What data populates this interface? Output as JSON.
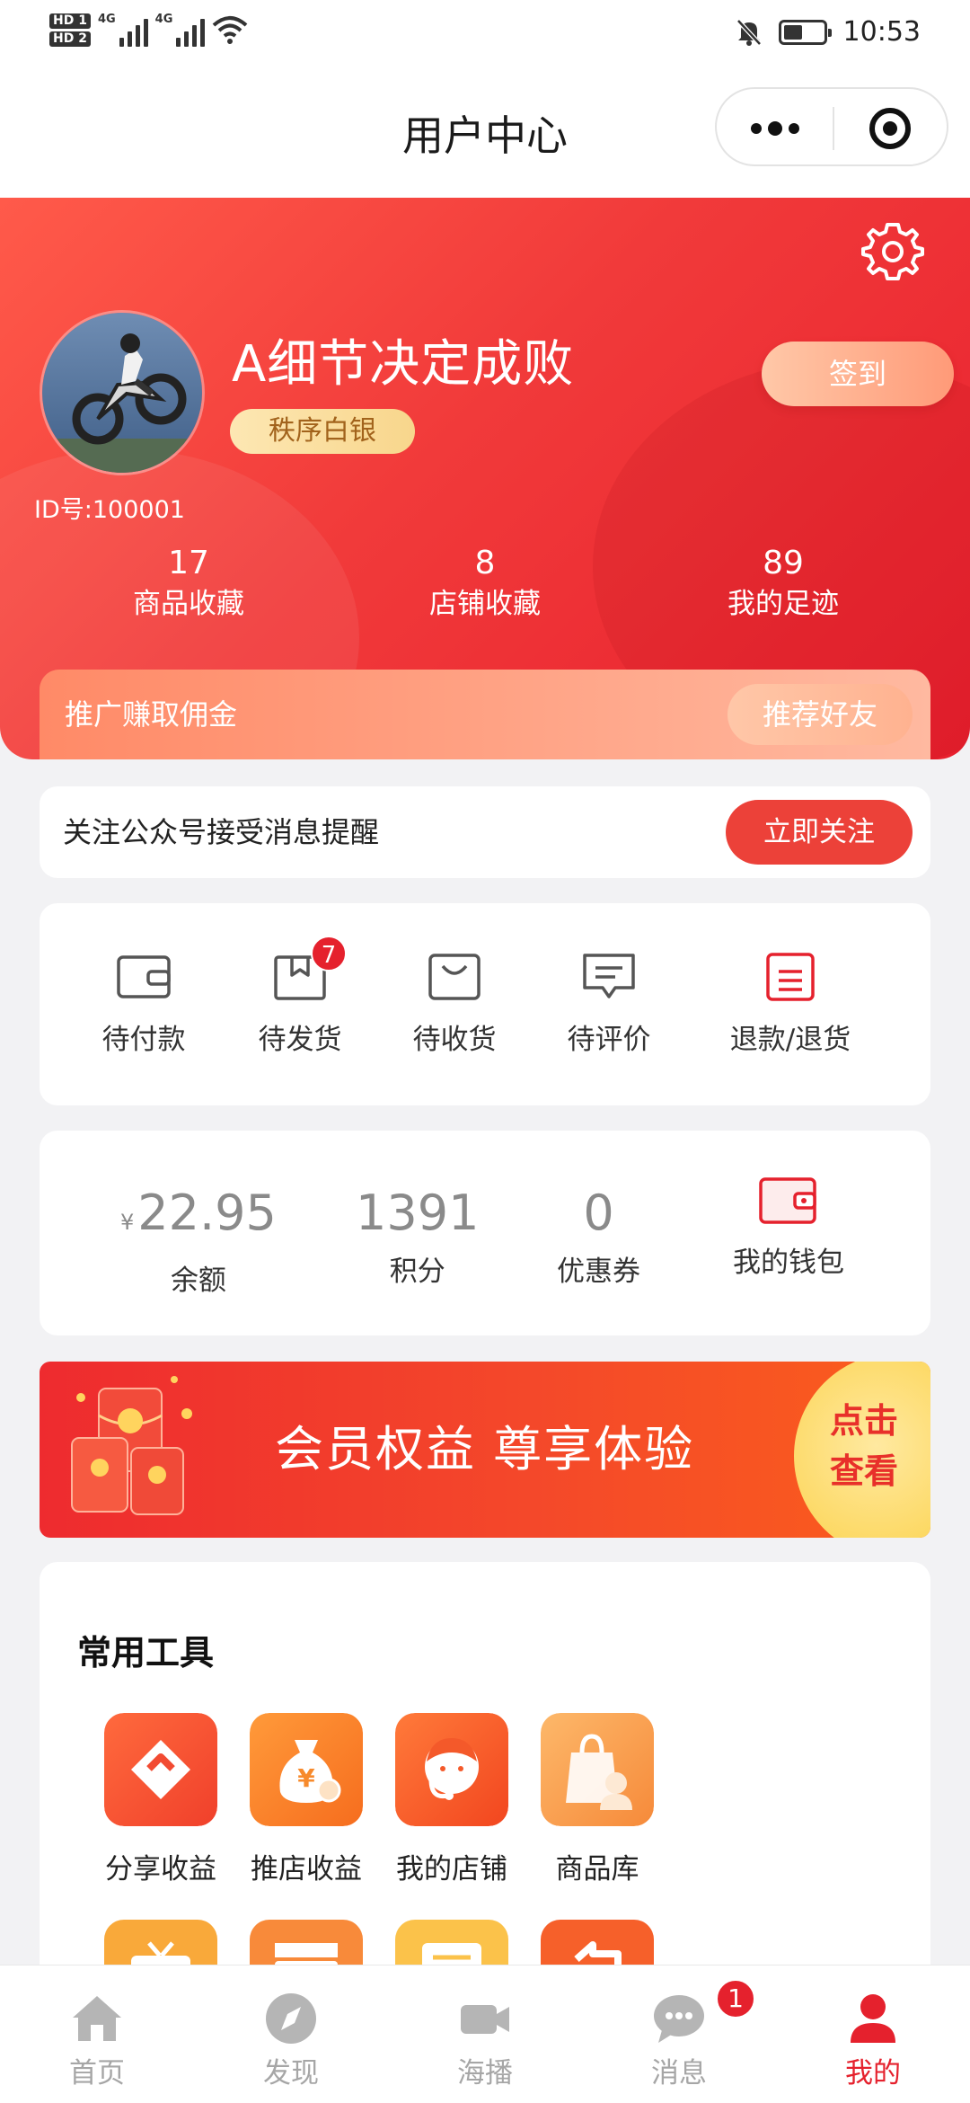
{
  "status_bar": {
    "hd1": "HD 1",
    "hd2": "HD 2",
    "net1": "4G",
    "net2": "4G",
    "time": "10:53",
    "icons": [
      "signal-icon",
      "wifi-icon",
      "mute-icon",
      "battery-icon"
    ]
  },
  "nav": {
    "title": "用户中心",
    "more_icon": "more-dots-icon",
    "close_icon": "miniprogram-target-icon"
  },
  "profile": {
    "name": "A细节决定成败",
    "level": "秩序白银",
    "id_text": "ID号:100001",
    "signin_label": "签到",
    "settings_icon": "gear-icon"
  },
  "stats": [
    {
      "value": "17",
      "label": "商品收藏"
    },
    {
      "value": "8",
      "label": "店铺收藏"
    },
    {
      "value": "89",
      "label": "我的足迹"
    }
  ],
  "promo": {
    "text": "推广赚取佣金",
    "button": "推荐好友"
  },
  "follow": {
    "text": "关注公众号接受消息提醒",
    "button": "立即关注"
  },
  "orders": [
    {
      "label": "待付款",
      "icon": "wallet-icon"
    },
    {
      "label": "待发货",
      "icon": "box-icon",
      "badge": "7"
    },
    {
      "label": "待收货",
      "icon": "bag-icon"
    },
    {
      "label": "待评价",
      "icon": "comment-icon"
    },
    {
      "label": "退款/退货",
      "icon": "refund-icon"
    }
  ],
  "wallet": {
    "currency": "¥",
    "balance": "22.95",
    "balance_label": "余额",
    "points": "1391",
    "points_label": "积分",
    "coupons": "0",
    "coupons_label": "优惠券",
    "wallet_label": "我的钱包",
    "wallet_icon": "wallet-icon"
  },
  "vip_banner": {
    "title": "会员权益 尊享体验",
    "cta": "点击查看"
  },
  "tools": {
    "title": "常用工具",
    "items": [
      {
        "label": "分享收益",
        "icon": "handshake-icon"
      },
      {
        "label": "推店收益",
        "icon": "money-bag-icon"
      },
      {
        "label": "我的店铺",
        "icon": "shopkeeper-icon"
      },
      {
        "label": "商品库",
        "icon": "shopping-bag-icon"
      }
    ],
    "row2_icons": [
      "tv-icon",
      "clapper-icon",
      "document-icon",
      "return-icon"
    ]
  },
  "tabs": [
    {
      "label": "首页",
      "icon": "home-icon"
    },
    {
      "label": "发现",
      "icon": "compass-icon"
    },
    {
      "label": "海播",
      "icon": "video-camera-icon"
    },
    {
      "label": "消息",
      "icon": "chat-icon",
      "badge": "1"
    },
    {
      "label": "我的",
      "icon": "profile-icon",
      "active": true
    }
  ],
  "colors": {
    "brand_red": "#e5212d",
    "header_gradient_start": "#ff5a4a",
    "header_gradient_end": "#e8202e",
    "gold_badge": "#f8d68c"
  }
}
